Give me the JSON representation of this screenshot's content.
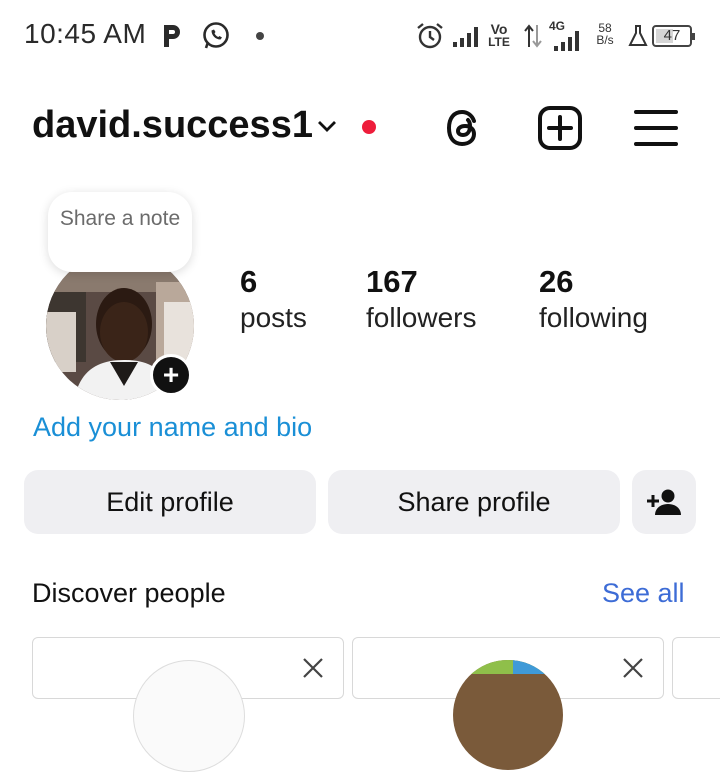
{
  "status_bar": {
    "time": "10:45 AM",
    "volte": [
      "Vo",
      "LTE"
    ],
    "network": "4G",
    "speed": [
      "58",
      "B/s"
    ],
    "battery": "47",
    "icons": [
      "parking-icon",
      "whatsapp-icon",
      "dot-icon",
      "alarm-icon",
      "signal-icon",
      "data-arrows-icon",
      "flask-icon",
      "battery-icon"
    ]
  },
  "header": {
    "username": "david.success1",
    "icons": [
      "chevron-down-icon",
      "live-dot-icon",
      "threads-icon",
      "create-icon",
      "menu-icon"
    ]
  },
  "profile": {
    "note_text": "Share a note",
    "stats": [
      {
        "value": "6",
        "label": "posts"
      },
      {
        "value": "167",
        "label": "followers"
      },
      {
        "value": "26",
        "label": "following"
      }
    ],
    "bio_link": "Add your name and bio"
  },
  "actions": {
    "edit_profile": "Edit profile",
    "share_profile": "Share profile"
  },
  "discover": {
    "title": "Discover people",
    "see_all": "See all"
  },
  "colors": {
    "link_blue": "#1a8fd6",
    "see_all_blue": "#3d6cd6",
    "live_red": "#ee1d3b",
    "button_bg": "#efeff2"
  }
}
